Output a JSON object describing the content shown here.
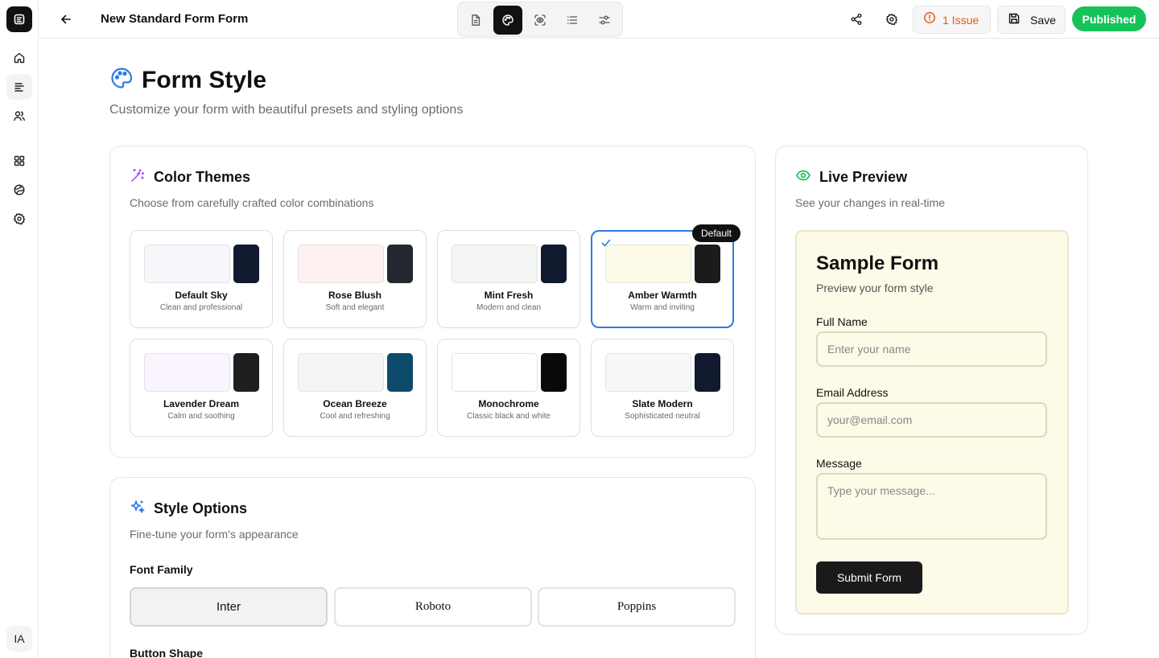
{
  "topbar": {
    "title": "New Standard Form Form",
    "issues_label": "1 Issue",
    "save_label": "Save",
    "published_label": "Published"
  },
  "rail": {
    "avatar_initials": "IA"
  },
  "page": {
    "title": "Form Style",
    "subtitle": "Customize your form with beautiful presets and styling options"
  },
  "themes_card": {
    "title": "Color Themes",
    "subtitle": "Choose from carefully crafted color combinations",
    "default_badge": "Default",
    "selected_index": 3,
    "themes": [
      {
        "name": "Default Sky",
        "desc": "Clean and professional",
        "light": "#f7f7fb",
        "dark": "#111a2e"
      },
      {
        "name": "Rose Blush",
        "desc": "Soft and elegant",
        "light": "#fdf1f1",
        "dark": "#23272f"
      },
      {
        "name": "Mint Fresh",
        "desc": "Modern and clean",
        "light": "#f4f5f5",
        "dark": "#101a2e"
      },
      {
        "name": "Amber Warmth",
        "desc": "Warm and inviting",
        "light": "#fdfae8",
        "dark": "#1c1b1b"
      },
      {
        "name": "Lavender Dream",
        "desc": "Calm and soothing",
        "light": "#f9f4fd",
        "dark": "#1e1e20"
      },
      {
        "name": "Ocean Breeze",
        "desc": "Cool and refreshing",
        "light": "#f4f5f6",
        "dark": "#0e4a6c"
      },
      {
        "name": "Monochrome",
        "desc": "Classic black and white",
        "light": "#ffffff",
        "dark": "#0a0a0a"
      },
      {
        "name": "Slate Modern",
        "desc": "Sophisticated neutral",
        "light": "#f6f7f9",
        "dark": "#111a2e"
      }
    ]
  },
  "style_card": {
    "title": "Style Options",
    "subtitle": "Fine-tune your form's appearance",
    "font_family_label": "Font Family",
    "fonts": [
      "Inter",
      "Roboto",
      "Poppins"
    ],
    "selected_font": "Inter",
    "button_shape_label": "Button Shape"
  },
  "preview_card": {
    "title": "Live Preview",
    "subtitle": "See your changes in real-time",
    "form_title": "Sample Form",
    "form_subtitle": "Preview your form style",
    "full_name_label": "Full Name",
    "full_name_placeholder": "Enter your name",
    "email_label": "Email Address",
    "email_placeholder": "your@email.com",
    "message_label": "Message",
    "message_placeholder": "Type your message...",
    "submit_label": "Submit Form"
  },
  "colors": {
    "accent_blue": "#2d7be5",
    "published_green": "#16c35a",
    "issue_orange": "#e8590c",
    "preview_bg": "#fdfae8"
  },
  "icons": [
    "logo-icon",
    "home-icon",
    "forms-icon",
    "users-icon",
    "grid-icon",
    "globe-icon",
    "settings-icon",
    "back-arrow-icon",
    "document-icon",
    "palette-icon",
    "scan-eye-icon",
    "list-icon",
    "sliders-icon",
    "share-icon",
    "gear-icon",
    "alert-icon",
    "save-icon",
    "wand-icon",
    "sparkles-icon",
    "eye-icon",
    "check-icon"
  ]
}
